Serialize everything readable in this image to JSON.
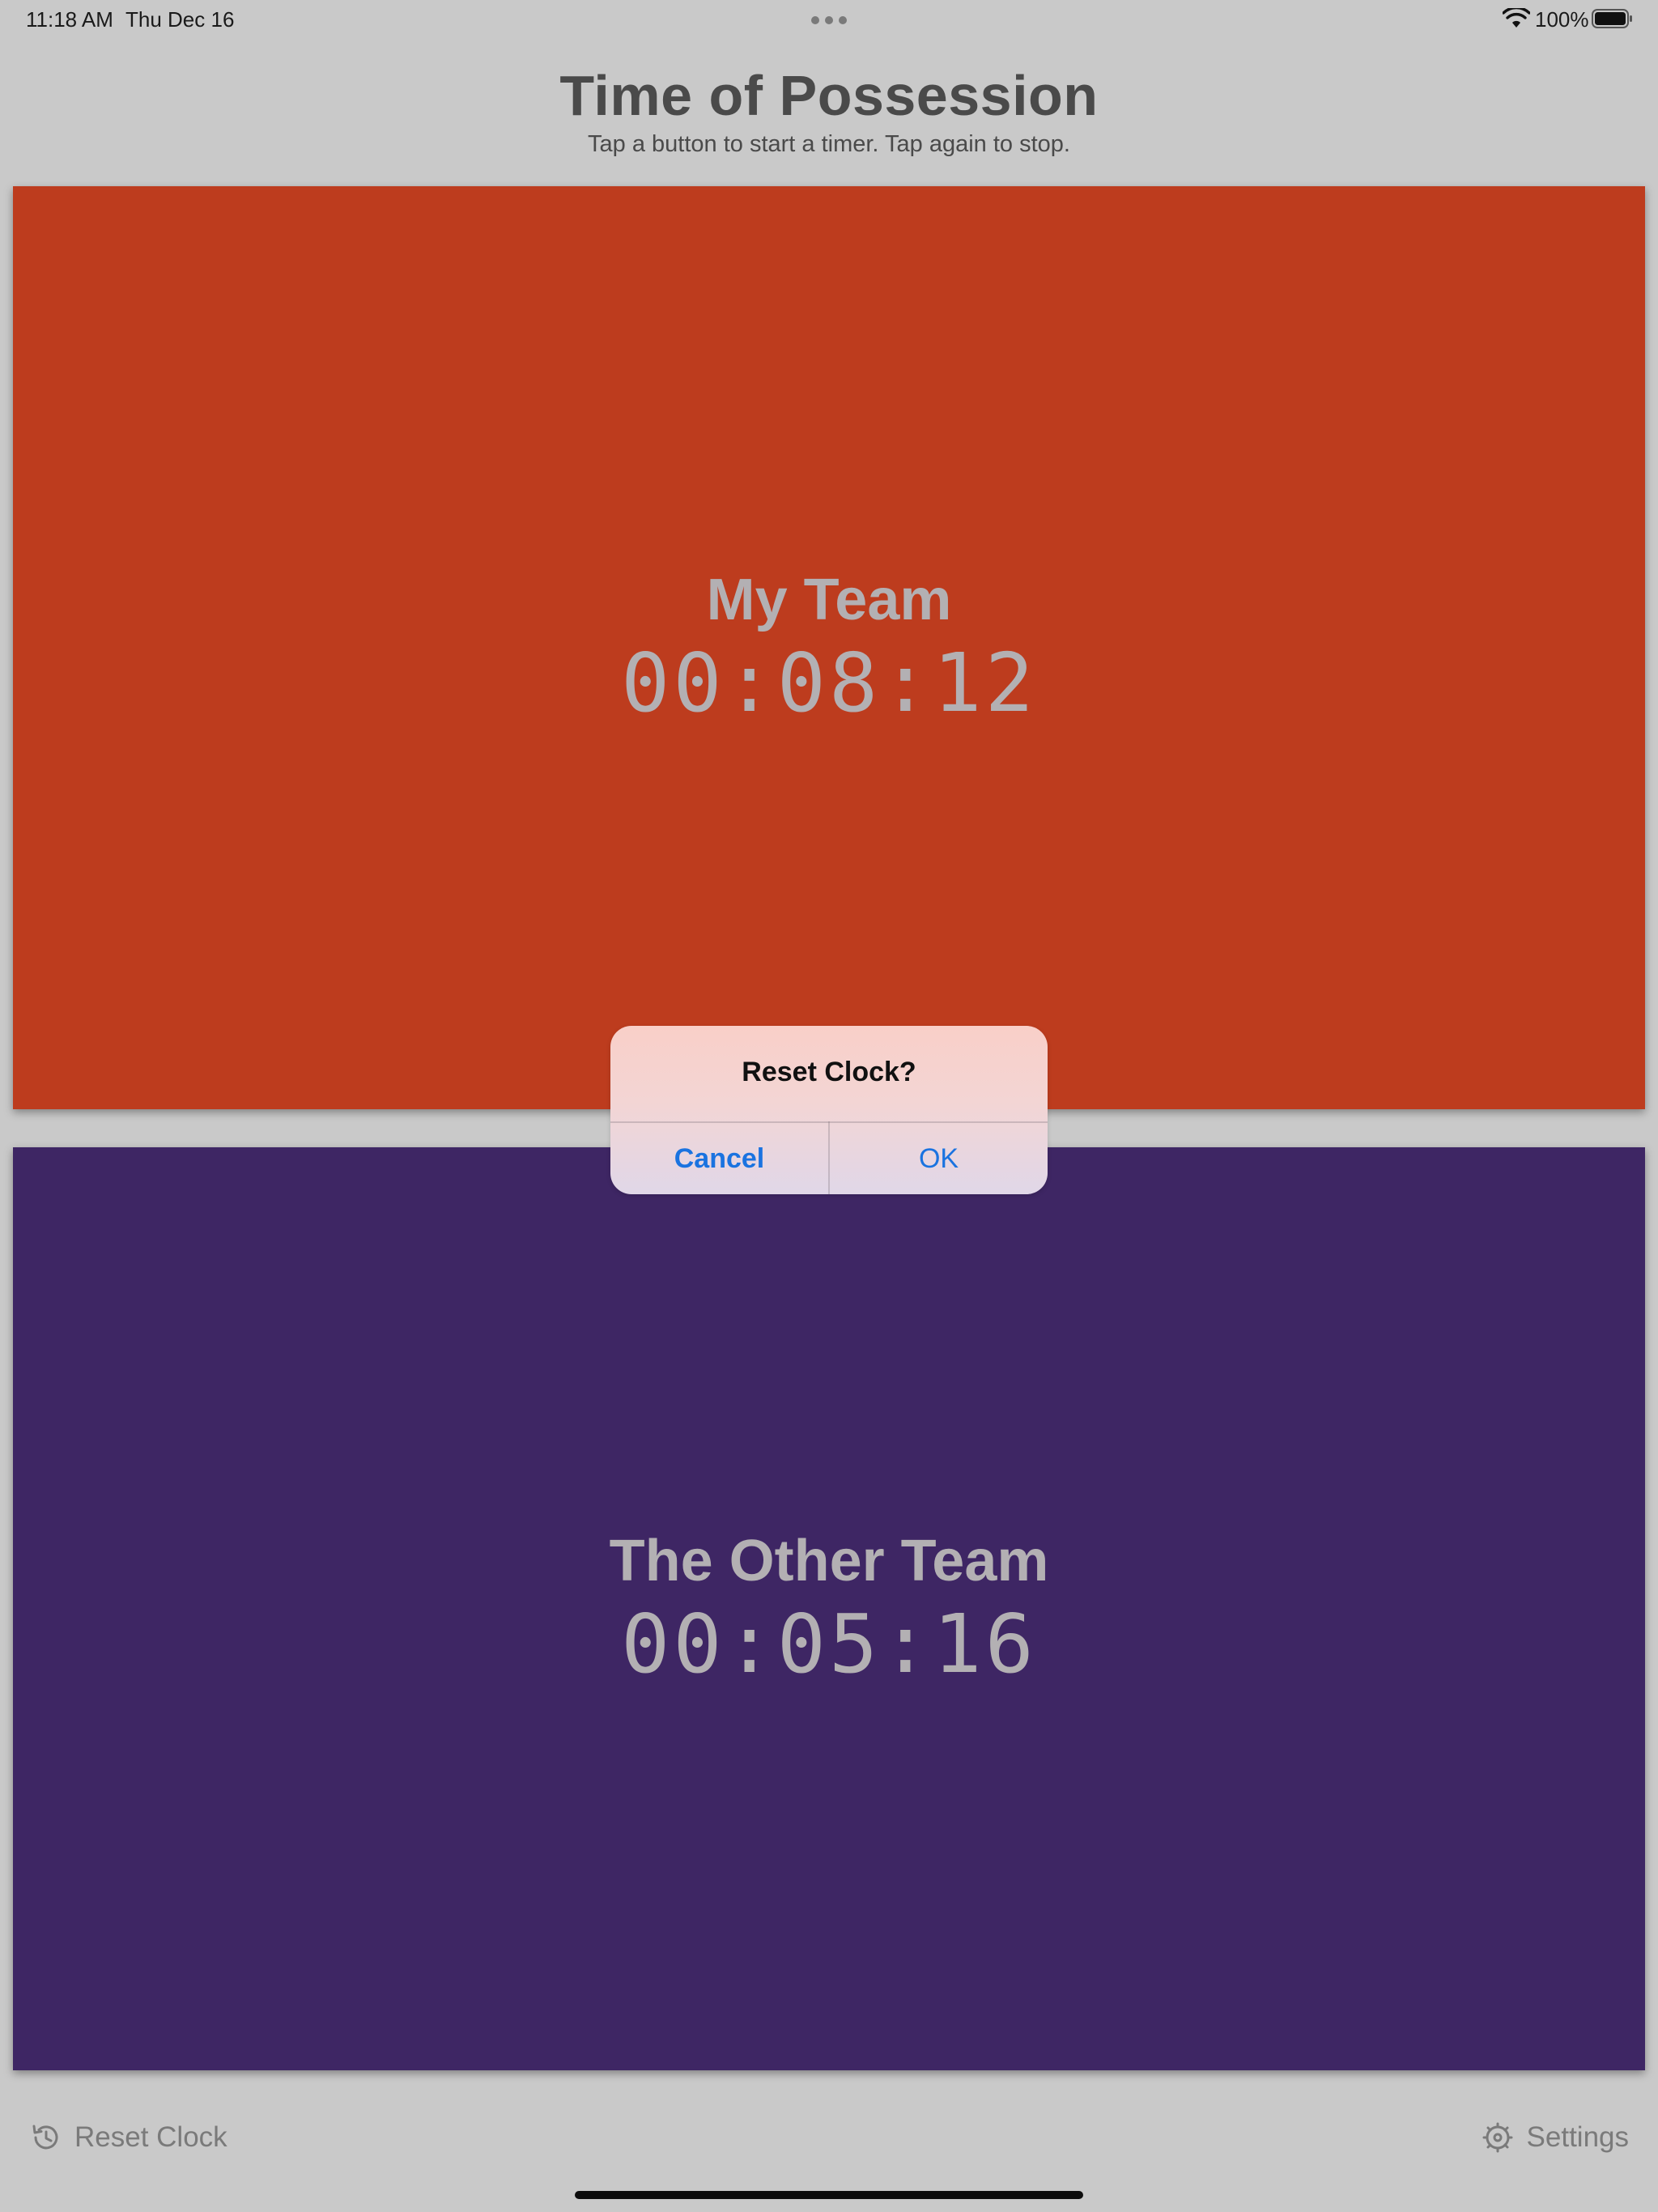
{
  "status_bar": {
    "time": "11:18 AM",
    "date": "Thu Dec 16",
    "battery_percent": "100%",
    "icons": [
      "wifi-icon",
      "battery-icon",
      "multitasking-dots-icon"
    ]
  },
  "header": {
    "title": "Time of Possession",
    "subtitle": "Tap a button to start a timer. Tap again to stop."
  },
  "teams": [
    {
      "name": "My Team",
      "timer": "00:08:12",
      "color": "#bd3c1e"
    },
    {
      "name": "The Other Team",
      "timer": "00:05:16",
      "color": "#3e2664"
    }
  ],
  "alert": {
    "title": "Reset Clock?",
    "cancel_label": "Cancel",
    "ok_label": "OK",
    "accent": "#1a73e0"
  },
  "toolbar": {
    "reset_label": "Reset Clock",
    "reset_icon": "clock-reset-icon",
    "settings_label": "Settings",
    "settings_icon": "gear-icon"
  },
  "colors": {
    "background": "#c9c9c9",
    "text_muted": "#7a7a7a",
    "team_text": "#b3b0b3"
  }
}
